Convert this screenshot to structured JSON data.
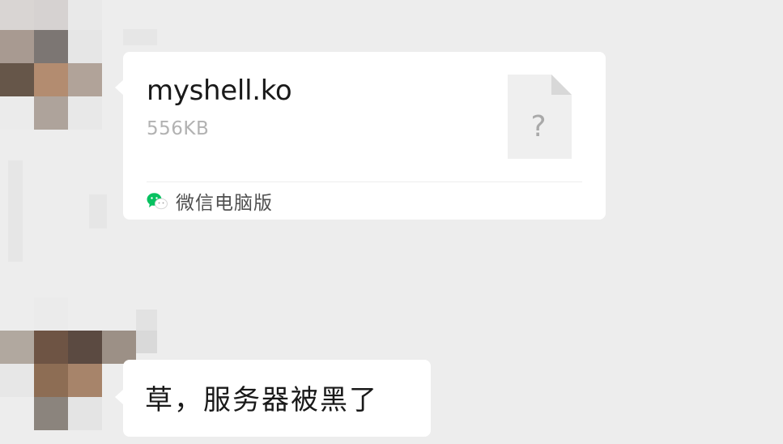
{
  "colors": {
    "background": "#ededed",
    "bubble": "#ffffff",
    "primary_text": "#191919",
    "secondary_text": "#b2b2b2",
    "wechat_green": "#07c160"
  },
  "messages": [
    {
      "type": "file",
      "file": {
        "name": "myshell.ko",
        "size": "556KB",
        "icon": "unknown-file-icon",
        "icon_glyph": "?"
      },
      "source": {
        "icon": "wechat-icon",
        "label": "微信电脑版"
      }
    },
    {
      "type": "text",
      "text": "草，服务器被黑了"
    }
  ]
}
